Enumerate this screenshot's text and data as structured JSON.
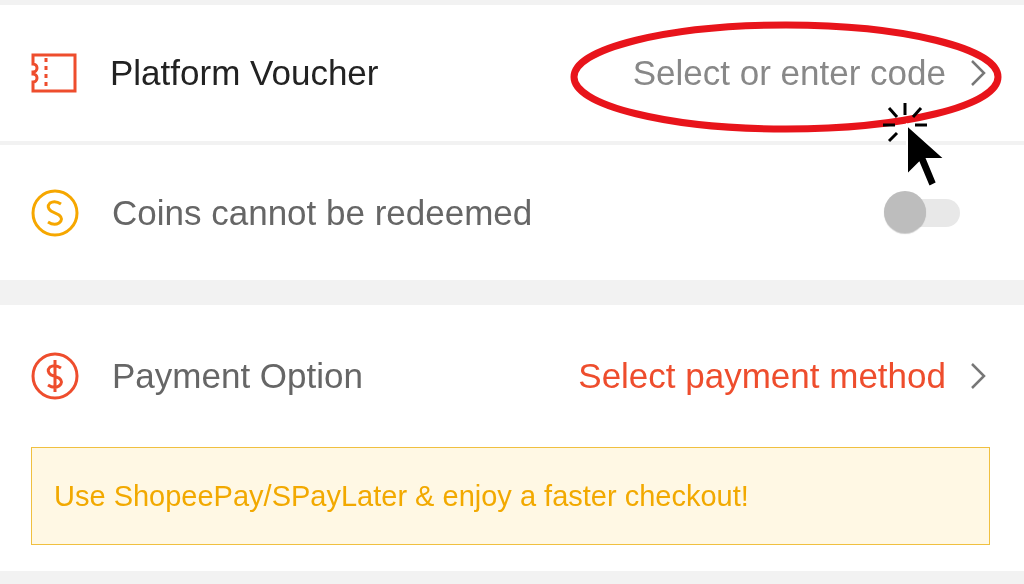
{
  "voucher": {
    "label": "Platform Voucher",
    "value": "Select or enter code"
  },
  "coins": {
    "label": "Coins cannot be redeemed",
    "disabled": true,
    "toggle": {
      "on": false
    }
  },
  "payment": {
    "label": "Payment Option",
    "value": "Select payment method",
    "banner": "Use ShopeePay/SPayLater & enjoy a faster checkout!"
  }
}
